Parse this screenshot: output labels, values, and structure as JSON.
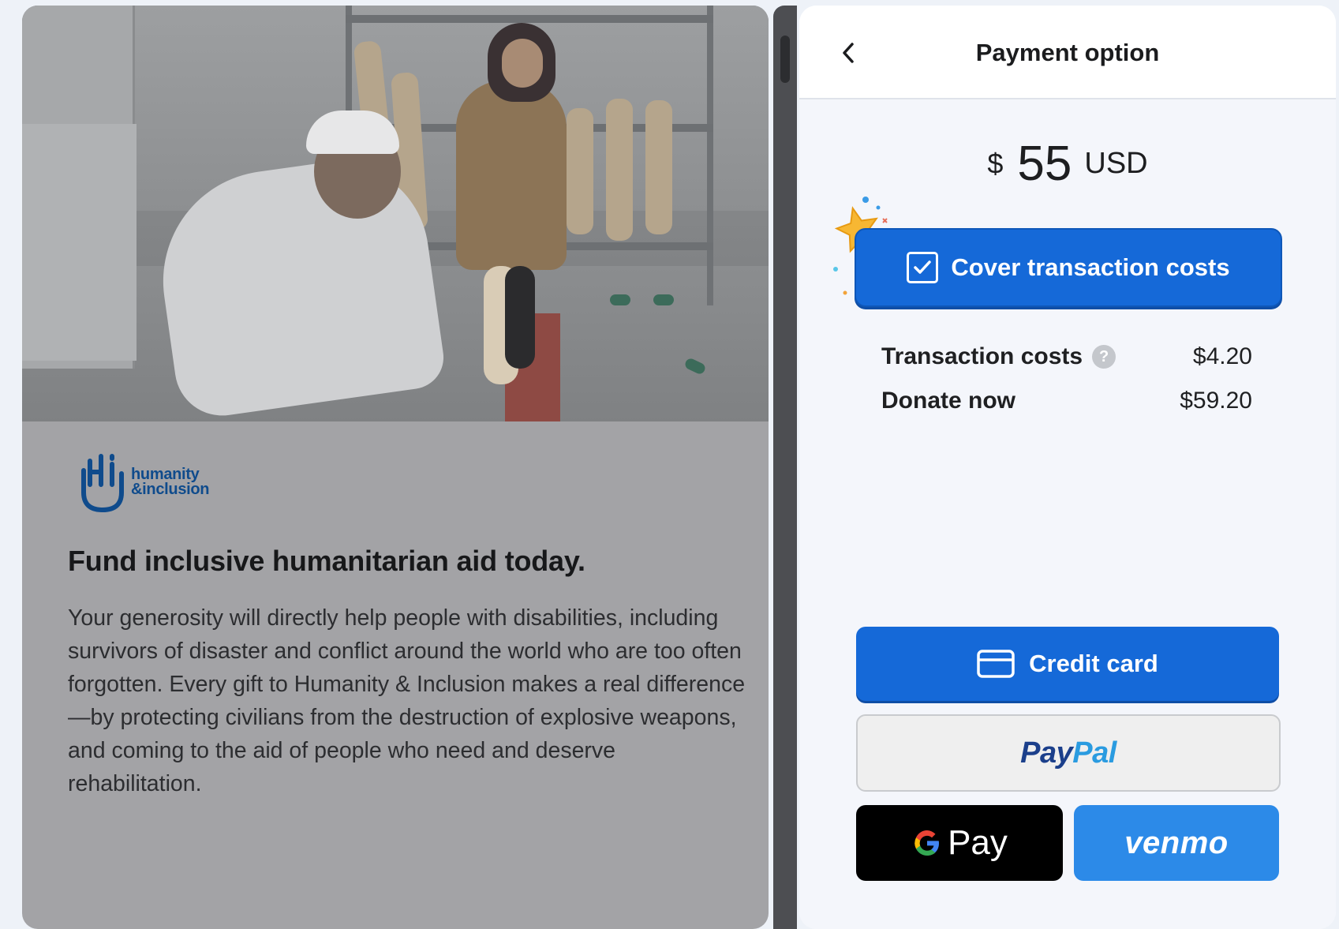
{
  "campaign": {
    "logo_text_line1": "humanity",
    "logo_text_line2": "&inclusion",
    "headline": "Fund inclusive humanitarian aid today.",
    "body": "Your generosity will directly help people with disabilities, including survivors of disaster and conflict around the world who are too often forgotten. Every gift to Humanity & Inclusion makes a real difference—by protecting civilians from the destruction of explosive weapons, and coming to the aid of people who need and deserve rehabilitation."
  },
  "payment": {
    "title": "Payment option",
    "back_icon": "chevron-left-icon",
    "amount": {
      "currency_symbol": "$",
      "value": "55",
      "currency_code": "USD"
    },
    "cover_costs": {
      "label": "Cover transaction costs",
      "checked": true
    },
    "costs": [
      {
        "label": "Transaction costs",
        "value": "$4.20",
        "has_help": true
      },
      {
        "label": "Donate now",
        "value": "$59.20",
        "has_help": false
      }
    ],
    "methods": {
      "credit_card": "Credit card",
      "paypal_part1": "Pay",
      "paypal_part2": "Pal",
      "gpay_g": "G",
      "gpay": "Pay",
      "venmo": "venmo"
    }
  },
  "colors": {
    "primary": "#1569d8",
    "venmo": "#2c8ae8",
    "paypal_dark": "#1b3f8b",
    "paypal_light": "#2a9be0",
    "logo": "#0f4b8c"
  }
}
